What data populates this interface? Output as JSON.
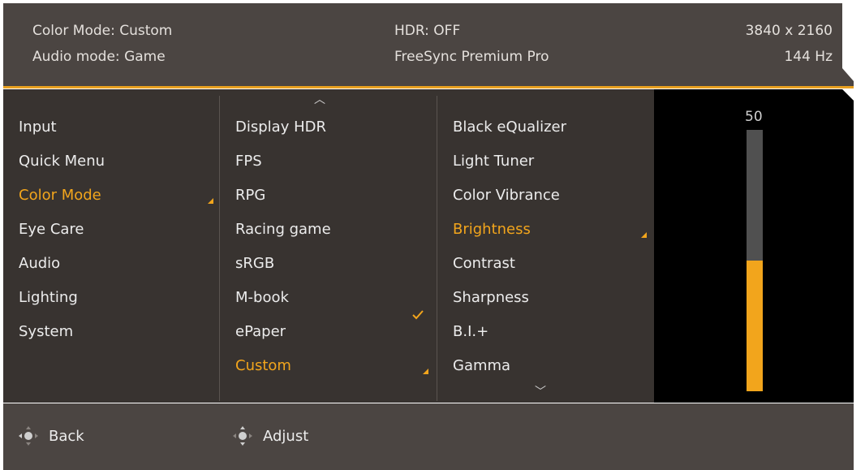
{
  "header": {
    "color_mode": "Color Mode: Custom",
    "audio_mode": "Audio mode: Game",
    "hdr": "HDR: OFF",
    "freesync": "FreeSync Premium Pro",
    "resolution": "3840 x 2160",
    "refresh": "144 Hz"
  },
  "menu1": {
    "items": [
      {
        "label": "Input"
      },
      {
        "label": "Quick Menu"
      },
      {
        "label": "Color Mode",
        "active": true
      },
      {
        "label": "Eye Care"
      },
      {
        "label": "Audio"
      },
      {
        "label": "Lighting"
      },
      {
        "label": "System"
      }
    ]
  },
  "menu2": {
    "items": [
      {
        "label": "Display HDR"
      },
      {
        "label": "FPS"
      },
      {
        "label": "RPG"
      },
      {
        "label": "Racing game"
      },
      {
        "label": "sRGB"
      },
      {
        "label": "M-book"
      },
      {
        "label": "ePaper"
      },
      {
        "label": "Custom",
        "active": true
      }
    ]
  },
  "menu3": {
    "items": [
      {
        "label": "Black eQualizer"
      },
      {
        "label": "Light Tuner"
      },
      {
        "label": "Color Vibrance"
      },
      {
        "label": "Brightness",
        "active": true
      },
      {
        "label": "Contrast"
      },
      {
        "label": "Sharpness"
      },
      {
        "label": "B.I.+"
      },
      {
        "label": "Gamma"
      }
    ]
  },
  "slider": {
    "value": "50",
    "level": 0.5
  },
  "footer": {
    "back": "Back",
    "adjust": "Adjust"
  },
  "colors": {
    "accent": "#f2a51c",
    "panel": "#383330",
    "header": "#4b4542"
  }
}
